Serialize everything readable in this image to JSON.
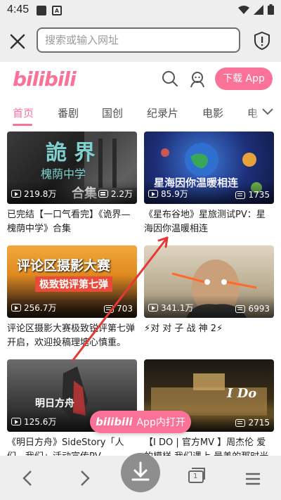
{
  "status": {
    "time": "4:45"
  },
  "browser": {
    "search_placeholder": "搜索或输入网址"
  },
  "header": {
    "logo": "bilibili",
    "download_label": "下载 App"
  },
  "tabs": [
    "首页",
    "番剧",
    "国创",
    "纪录片",
    "电影",
    "电"
  ],
  "cards": [
    {
      "views": "219.8万",
      "danmaku": "2.2万",
      "title": "已完结【一口气看完】《诡界—槐荫中学》合集",
      "overlay": "合集"
    },
    {
      "views": "85.9万",
      "danmaku": "1735",
      "title": "《星布谷地》星旅测试PV：星海因你温暖相连",
      "overlay": "星海因你温暖相连"
    },
    {
      "views": "256.7万",
      "danmaku": "703",
      "title": "评论区摄影大赛极致锐评第七弹开启，欢迎投稿理塘心慎重。",
      "overlay": "评论区摄影大赛",
      "overlay2": "极致锐评第七弹"
    },
    {
      "views": "341.1万",
      "danmaku": "6993",
      "title": "⚡对 对 子 战 神 2⚡",
      "overlay": ""
    },
    {
      "views": "125.6万",
      "danmaku": "",
      "title": "《明日方舟》SideStory「人们，我们」活动宣传PV",
      "overlay": "明日方舟"
    },
    {
      "views": "",
      "danmaku": "2715",
      "title": "【I DO | 官方MV 】周杰伦 爱的模样 我们遇上 最美的那时光",
      "overlay": "I Do"
    }
  ],
  "floating": {
    "logo": "bilibili",
    "label": "App内打开"
  },
  "bottom": {
    "tab_count": "1"
  },
  "colors": {
    "brand_pink": "#fb7299",
    "bar_gray": "#eeeeee"
  }
}
